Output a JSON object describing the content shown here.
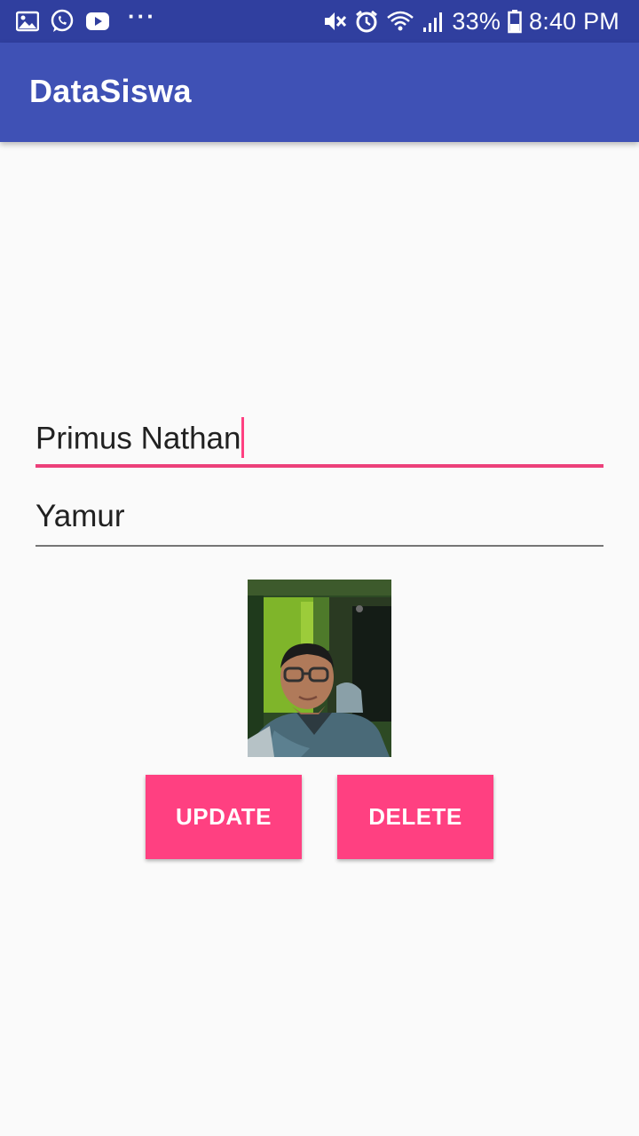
{
  "status_bar": {
    "battery": "33%",
    "time": "8:40 PM",
    "more": "···",
    "left_icons": [
      "gallery-icon",
      "whatsapp-icon",
      "youtube-icon",
      "more-icon"
    ],
    "right_icons": [
      "mute-icon",
      "alarm-icon",
      "wifi-icon",
      "signal-icon",
      "battery-icon"
    ]
  },
  "app_bar": {
    "title": "DataSiswa",
    "color": "#3f51b5"
  },
  "form": {
    "name_value": "Primus Nathan",
    "second_value": "Yamur"
  },
  "photo": {
    "icon": "student-photo"
  },
  "buttons": {
    "update_label": "UPDATE",
    "delete_label": "DELETE",
    "color": "#ff4081"
  }
}
